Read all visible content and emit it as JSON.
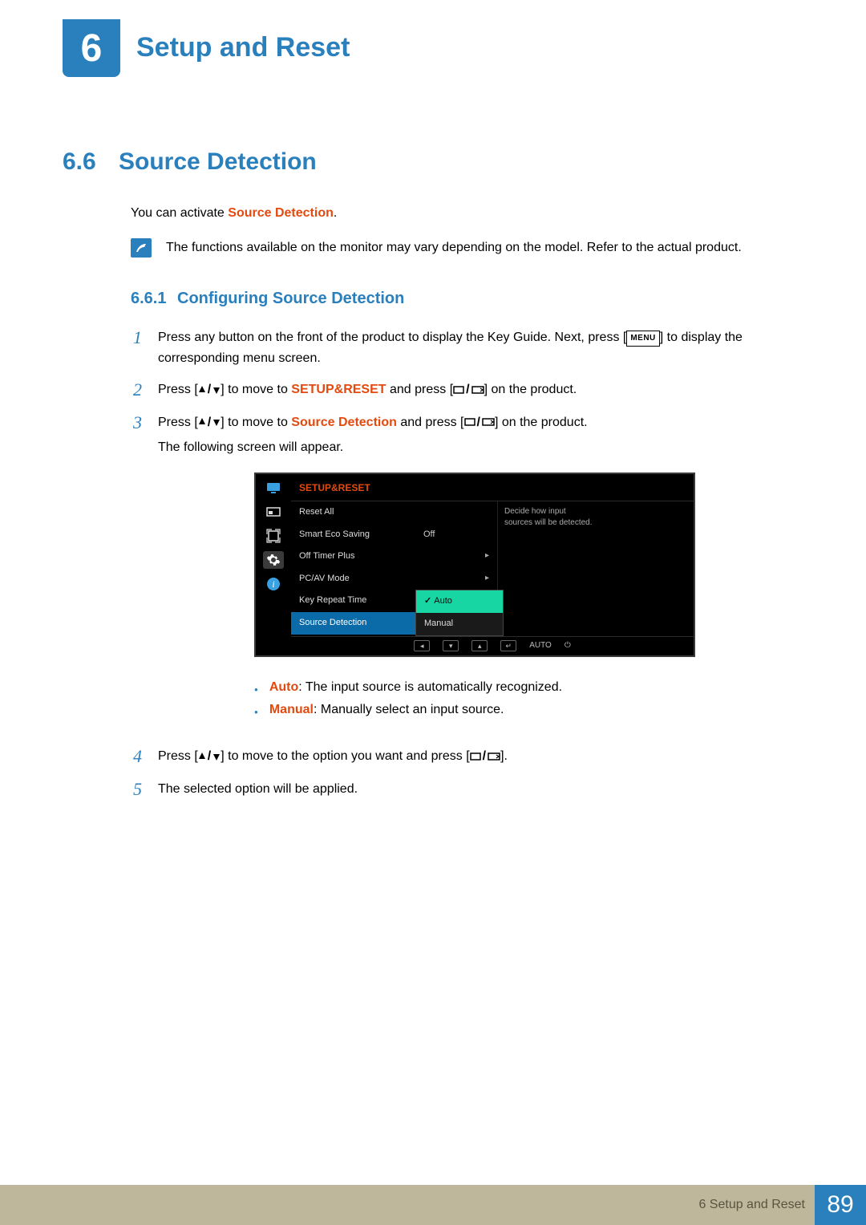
{
  "chapter": {
    "number": "6",
    "title": "Setup and Reset"
  },
  "section": {
    "number": "6.6",
    "title": "Source Detection"
  },
  "intro": {
    "prefix": "You can activate ",
    "highlight": "Source Detection",
    "suffix": "."
  },
  "note": "The functions available on the monitor may vary depending on the model. Refer to the actual product.",
  "subsection": {
    "number": "6.6.1",
    "title": "Configuring Source Detection"
  },
  "steps": {
    "s1_a": "Press any button on the front of the product to display the Key Guide. Next, press [",
    "s1_menu": "MENU",
    "s1_b": "] to display the corresponding menu screen.",
    "s2_a": "Press [",
    "s2_b": "] to move to ",
    "s2_hl": "SETUP&RESET",
    "s2_c": " and press [",
    "s2_d": "] on the product.",
    "s3_a": "Press [",
    "s3_b": "] to move to ",
    "s3_hl": "Source Detection",
    "s3_c": " and press [",
    "s3_d": "] on the product.",
    "s3_line2": "The following screen will appear.",
    "s4_a": "Press [",
    "s4_b": "] to move to the option you want and press [",
    "s4_c": "].",
    "s5": "The selected option will be applied."
  },
  "osd": {
    "title": "SETUP&RESET",
    "rows": [
      {
        "label": "Reset All",
        "value": ""
      },
      {
        "label": "Smart Eco Saving",
        "value": "Off"
      },
      {
        "label": "Off Timer Plus",
        "value": "arrow"
      },
      {
        "label": "PC/AV Mode",
        "value": "arrow"
      },
      {
        "label": "Key Repeat Time",
        "value": ""
      },
      {
        "label": "Source Detection",
        "value": ""
      }
    ],
    "popup": {
      "selected": "Auto",
      "other": "Manual"
    },
    "desc": "Decide how input sources will be detected.",
    "nav_auto": "AUTO"
  },
  "bullets": {
    "auto_hl": "Auto",
    "auto_txt": ": The input source is automatically recognized.",
    "manual_hl": "Manual",
    "manual_txt": ": Manually select an input source."
  },
  "footer": {
    "label": "6 Setup and Reset",
    "page": "89"
  }
}
